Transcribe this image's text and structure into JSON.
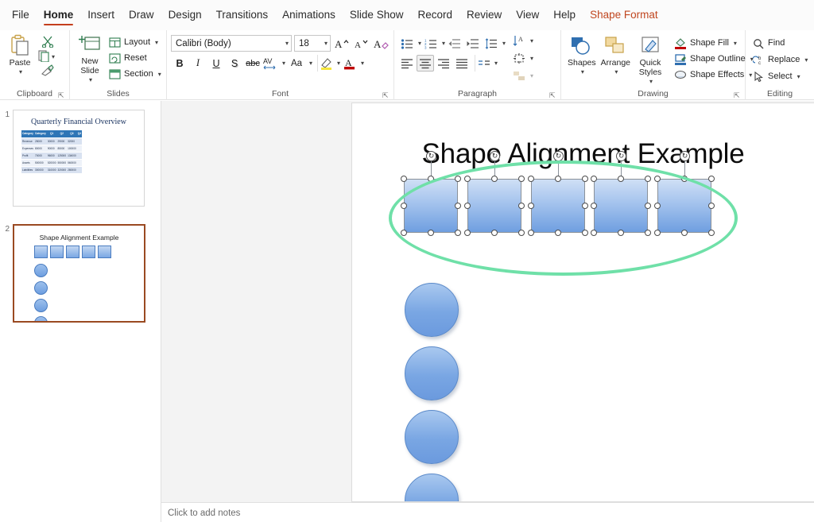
{
  "window": {
    "app": "PowerPoint"
  },
  "tabs": [
    {
      "label": "File",
      "state": "normal"
    },
    {
      "label": "Home",
      "state": "active"
    },
    {
      "label": "Insert",
      "state": "normal"
    },
    {
      "label": "Draw",
      "state": "normal"
    },
    {
      "label": "Design",
      "state": "normal"
    },
    {
      "label": "Transitions",
      "state": "normal"
    },
    {
      "label": "Animations",
      "state": "normal"
    },
    {
      "label": "Slide Show",
      "state": "normal"
    },
    {
      "label": "Record",
      "state": "normal"
    },
    {
      "label": "Review",
      "state": "normal"
    },
    {
      "label": "View",
      "state": "normal"
    },
    {
      "label": "Help",
      "state": "normal"
    },
    {
      "label": "Shape Format",
      "state": "contextual"
    }
  ],
  "ribbon": {
    "clipboard": {
      "group_label": "Clipboard",
      "paste_label": "Paste",
      "cut_icon": "scissors-icon",
      "copy_icon": "copy-icon",
      "format_painter_icon": "format-painter-icon"
    },
    "slides": {
      "group_label": "Slides",
      "new_slide_label": "New Slide",
      "layout_label": "Layout",
      "reset_label": "Reset",
      "section_label": "Section"
    },
    "font": {
      "group_label": "Font",
      "font_name": "Calibri (Body)",
      "font_size": "18",
      "grow_font": "A",
      "shrink_font": "A",
      "clear_formatting": "clear-formatting-icon",
      "bold": "B",
      "italic": "I",
      "underline": "U",
      "shadow": "S",
      "strikethrough": "abc",
      "character_spacing": "AV",
      "change_case": "Aa",
      "highlight": "highlight-icon",
      "font_color": "A"
    },
    "paragraph": {
      "group_label": "Paragraph",
      "bullets": "bullets-icon",
      "numbering": "numbering-icon",
      "decrease_indent": "decrease-indent-icon",
      "increase_indent": "increase-indent-icon",
      "line_spacing": "line-spacing-icon",
      "text_direction": "text-direction-icon",
      "align_text": "align-text-icon",
      "convert_smartart": "smartart-icon",
      "align_left": "align-left-icon",
      "align_center": "align-center-icon",
      "align_right": "align-right-icon",
      "justify": "justify-icon",
      "columns": "columns-icon"
    },
    "drawing": {
      "group_label": "Drawing",
      "shapes_label": "Shapes",
      "arrange_label": "Arrange",
      "quick_styles_label": "Quick Styles",
      "shape_fill_label": "Shape Fill",
      "shape_outline_label": "Shape Outline",
      "shape_effects_label": "Shape Effects"
    },
    "editing": {
      "group_label": "Editing",
      "find_label": "Find",
      "replace_label": "Replace",
      "select_label": "Select"
    }
  },
  "slide_panel": {
    "slides": [
      {
        "number": "1",
        "selected": false,
        "title": "Quarterly Financial Overview",
        "table": {
          "headers": [
            "Category",
            "Category",
            "Q1",
            "Q2",
            "Q3",
            "Q4"
          ],
          "rows": [
            [
              "Revenue",
              "25000",
              "30000",
              "29000",
              "32000"
            ],
            [
              "Expenses",
              "80000",
              "90000",
              "85000",
              "100000"
            ],
            [
              "Profit",
              "70000",
              "96000",
              "125000",
              "134000"
            ],
            [
              "Assets",
              "500000",
              "520000",
              "550000",
              "560000"
            ],
            [
              "Liabilities",
              "300000",
              "310000",
              "320000",
              "280000"
            ]
          ]
        }
      },
      {
        "number": "2",
        "selected": true,
        "title": "Shape Alignment Example"
      }
    ]
  },
  "canvas": {
    "slide_title": "Shape Alignment Example",
    "selected_shape_count": 5,
    "annotation": {
      "type": "ellipse",
      "color": "#6fe0a8"
    },
    "rotation_handle_glyph": "↻",
    "shapes": {
      "rectangles": 5,
      "circles": 4
    }
  },
  "notes": {
    "placeholder": "Click to add notes"
  }
}
